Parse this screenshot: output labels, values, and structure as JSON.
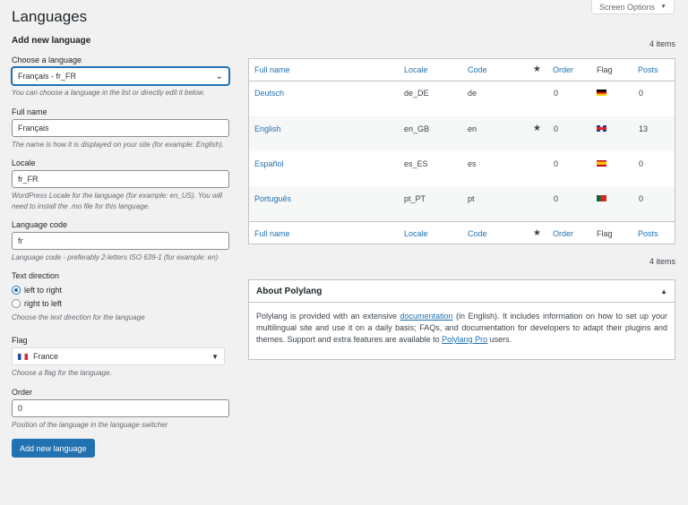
{
  "screen_options": {
    "label": "Screen Options"
  },
  "page_title": "Languages",
  "form": {
    "heading": "Add new language",
    "choose": {
      "label": "Choose a language",
      "value": "Français - fr_FR",
      "desc": "You can choose a language in the list or directly edit it below."
    },
    "full_name": {
      "label": "Full name",
      "value": "Français",
      "desc": "The name is how it is displayed on your site (for example: English)."
    },
    "locale": {
      "label": "Locale",
      "value": "fr_FR",
      "desc": "WordPress Locale for the language (for example: en_US). You will need to install the .mo file for this language."
    },
    "code": {
      "label": "Language code",
      "value": "fr",
      "desc": "Language code - preferably 2-letters ISO 639-1 (for example: en)"
    },
    "direction": {
      "label": "Text direction",
      "options": [
        "left to right",
        "right to left"
      ],
      "selected": "left to right",
      "desc": "Choose the text direction for the language"
    },
    "flag": {
      "label": "Flag",
      "value": "France",
      "desc": "Choose a flag for the language."
    },
    "order": {
      "label": "Order",
      "value": "0",
      "desc": "Position of the language in the language switcher"
    },
    "submit_label": "Add new language"
  },
  "table": {
    "count_top": "4 items",
    "count_bottom": "4 items",
    "columns": {
      "full_name": "Full name",
      "locale": "Locale",
      "code": "Code",
      "order": "Order",
      "flag": "Flag",
      "posts": "Posts"
    },
    "rows": [
      {
        "name": "Deutsch",
        "locale": "de_DE",
        "code": "de",
        "default": false,
        "order": "0",
        "flag": "de",
        "posts": "0"
      },
      {
        "name": "English",
        "locale": "en_GB",
        "code": "en",
        "default": true,
        "order": "0",
        "flag": "gb",
        "posts": "13"
      },
      {
        "name": "Español",
        "locale": "es_ES",
        "code": "es",
        "default": false,
        "order": "0",
        "flag": "es",
        "posts": "0"
      },
      {
        "name": "Português",
        "locale": "pt_PT",
        "code": "pt",
        "default": false,
        "order": "0",
        "flag": "pt",
        "posts": "0"
      }
    ]
  },
  "about": {
    "title": "About Polylang",
    "text_1": "Polylang is provided with an extensive ",
    "link_1": "documentation",
    "text_2": " (in English). It includes information on how to set up your multilingual site and use it on a daily basis; FAQs, and documentation for developers to adapt their plugins and themes. Support and extra features are available to ",
    "link_2": "Polylang Pro",
    "text_3": " users."
  },
  "colors": {
    "accent": "#2271b1",
    "text": "#3c434a",
    "background": "#f1f1f1"
  }
}
